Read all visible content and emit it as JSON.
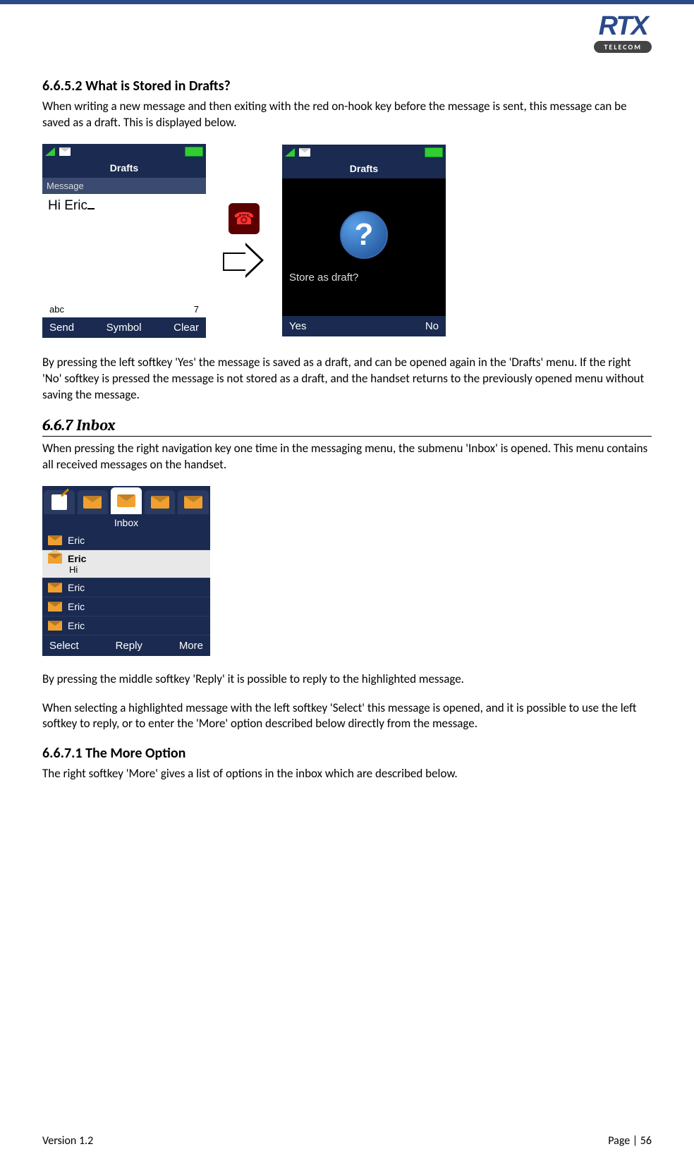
{
  "logo": {
    "main": "RTX",
    "sub": "TELECOM"
  },
  "h_6652": "6.6.5.2 What is Stored in Drafts?",
  "p1": "When writing a new message and then exiting with the red on-hook key before the message is sent, this message can be saved as a draft. This is displayed below.",
  "screen_drafts": {
    "title": "Drafts",
    "label": "Message",
    "text": "Hi Eric",
    "abc": "abc",
    "count": "7",
    "sk_left": "Send",
    "sk_mid": "Symbol",
    "sk_right": "Clear"
  },
  "screen_store": {
    "title": "Drafts",
    "question_mark": "?",
    "prompt": "Store as draft?",
    "sk_left": "Yes",
    "sk_right": "No"
  },
  "p2": "By pressing the left softkey 'Yes' the message is saved as a draft, and can be opened again in the 'Drafts' menu.  If the right 'No' softkey is pressed the message is not stored as a draft, and the handset returns to the previously opened menu without saving the message.",
  "h_667": "6.6.7 Inbox",
  "p3": "When pressing the right navigation key one time in the messaging menu, the submenu 'Inbox' is opened. This menu contains all received messages on the handset.",
  "inbox": {
    "title": "Inbox",
    "items": [
      {
        "name": "Eric"
      },
      {
        "name": "Eric",
        "preview": "Hi",
        "selected": true
      },
      {
        "name": "Eric"
      },
      {
        "name": "Eric"
      },
      {
        "name": "Eric"
      }
    ],
    "sk_left": "Select",
    "sk_mid": "Reply",
    "sk_right": "More"
  },
  "p4": "By pressing the middle softkey 'Reply' it is possible to reply to the highlighted message.",
  "p5": "When selecting a highlighted message with the left softkey 'Select' this message is opened, and it is possible to use the left softkey to reply, or to enter the 'More' option described below directly from the message.",
  "h_6671": "6.6.7.1 The More Option",
  "p6": "The right softkey 'More' gives a list of options in the inbox which are described below.",
  "footer": {
    "version": "Version 1.2",
    "page": "Page | 56"
  }
}
